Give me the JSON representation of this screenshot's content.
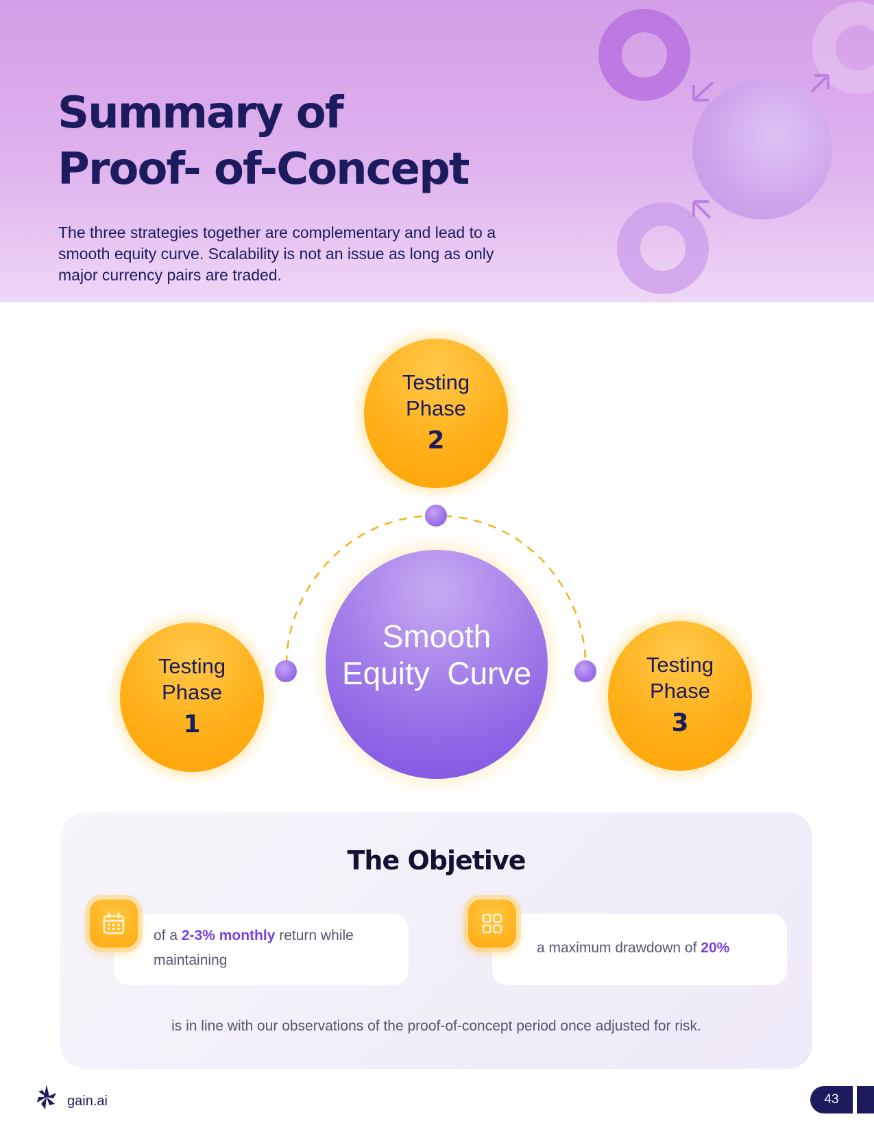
{
  "header": {
    "title_line1": "Summary of",
    "title_line2": "Proof- of-Concept",
    "intro": "The three strategies together are complementary and lead to a smooth equity curve. Scalability is not an issue as long as only major currency pairs are traded."
  },
  "diagram": {
    "center_label": "Smooth\nEquity  Curve",
    "phases": [
      {
        "label_line1": "Testing",
        "label_line2": "Phase",
        "number": "1"
      },
      {
        "label_line1": "Testing",
        "label_line2": "Phase",
        "number": "2"
      },
      {
        "label_line1": "Testing",
        "label_line2": "Phase",
        "number": "3"
      }
    ]
  },
  "objective": {
    "title": "The Objetive",
    "card1": {
      "icon": "calendar-icon",
      "text_before": "of a ",
      "highlight": "2-3% monthly",
      "text_after": " return while maintaining"
    },
    "card2": {
      "icon": "grid-icon",
      "text_before": "a maximum drawdown of ",
      "highlight": "20%"
    },
    "footer": "is in line with our observations of the proof-of-concept period once adjusted for risk."
  },
  "footer": {
    "brand": "gain.ai",
    "page_number": "43"
  },
  "colors": {
    "navy": "#1b1b5e",
    "orange": "#ffab12",
    "purple": "#8b5cdf",
    "highlight_purple": "#7a3fdc"
  }
}
